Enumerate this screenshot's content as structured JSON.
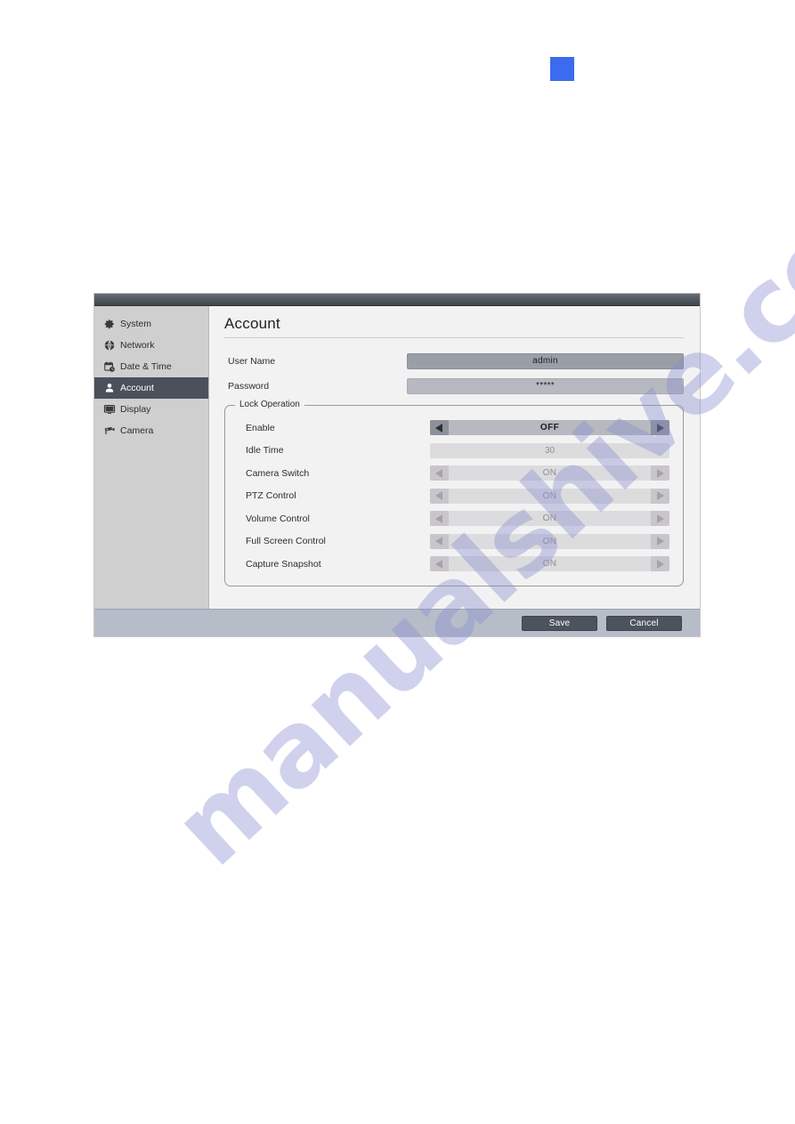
{
  "decor": {
    "blue_square_color": "#3b6cf0",
    "watermark_text": "manualshive.com"
  },
  "window": {
    "title_bar": "",
    "sidebar": {
      "items": [
        {
          "label": "System",
          "icon": "gear-icon",
          "selected": false
        },
        {
          "label": "Network",
          "icon": "network-globe-icon",
          "selected": false
        },
        {
          "label": "Date & Time",
          "icon": "calendar-clock-icon",
          "selected": false
        },
        {
          "label": "Account",
          "icon": "user-icon",
          "selected": true
        },
        {
          "label": "Display",
          "icon": "monitor-icon",
          "selected": false
        },
        {
          "label": "Camera",
          "icon": "camera-icon",
          "selected": false
        }
      ]
    },
    "content": {
      "page_title": "Account",
      "fields": [
        {
          "label": "User Name",
          "value": "admin",
          "state": "focused"
        },
        {
          "label": "Password",
          "value": "*****",
          "state": "normal"
        }
      ],
      "lock_group": {
        "legend": "Lock Operation",
        "rows": [
          {
            "label": "Enable",
            "value": "OFF",
            "type": "spinner",
            "state": "enabled"
          },
          {
            "label": "Idle Time",
            "value": "30",
            "type": "textbox",
            "state": "disabled"
          },
          {
            "label": "Camera Switch",
            "value": "ON",
            "type": "spinner",
            "state": "disabled"
          },
          {
            "label": "PTZ Control",
            "value": "ON",
            "type": "spinner",
            "state": "disabled"
          },
          {
            "label": "Volume Control",
            "value": "ON",
            "type": "spinner",
            "state": "disabled"
          },
          {
            "label": "Full Screen Control",
            "value": "ON",
            "type": "spinner",
            "state": "disabled"
          },
          {
            "label": "Capture Snapshot",
            "value": "ON",
            "type": "spinner",
            "state": "disabled"
          }
        ]
      }
    },
    "footer": {
      "save_label": "Save",
      "cancel_label": "Cancel"
    }
  }
}
